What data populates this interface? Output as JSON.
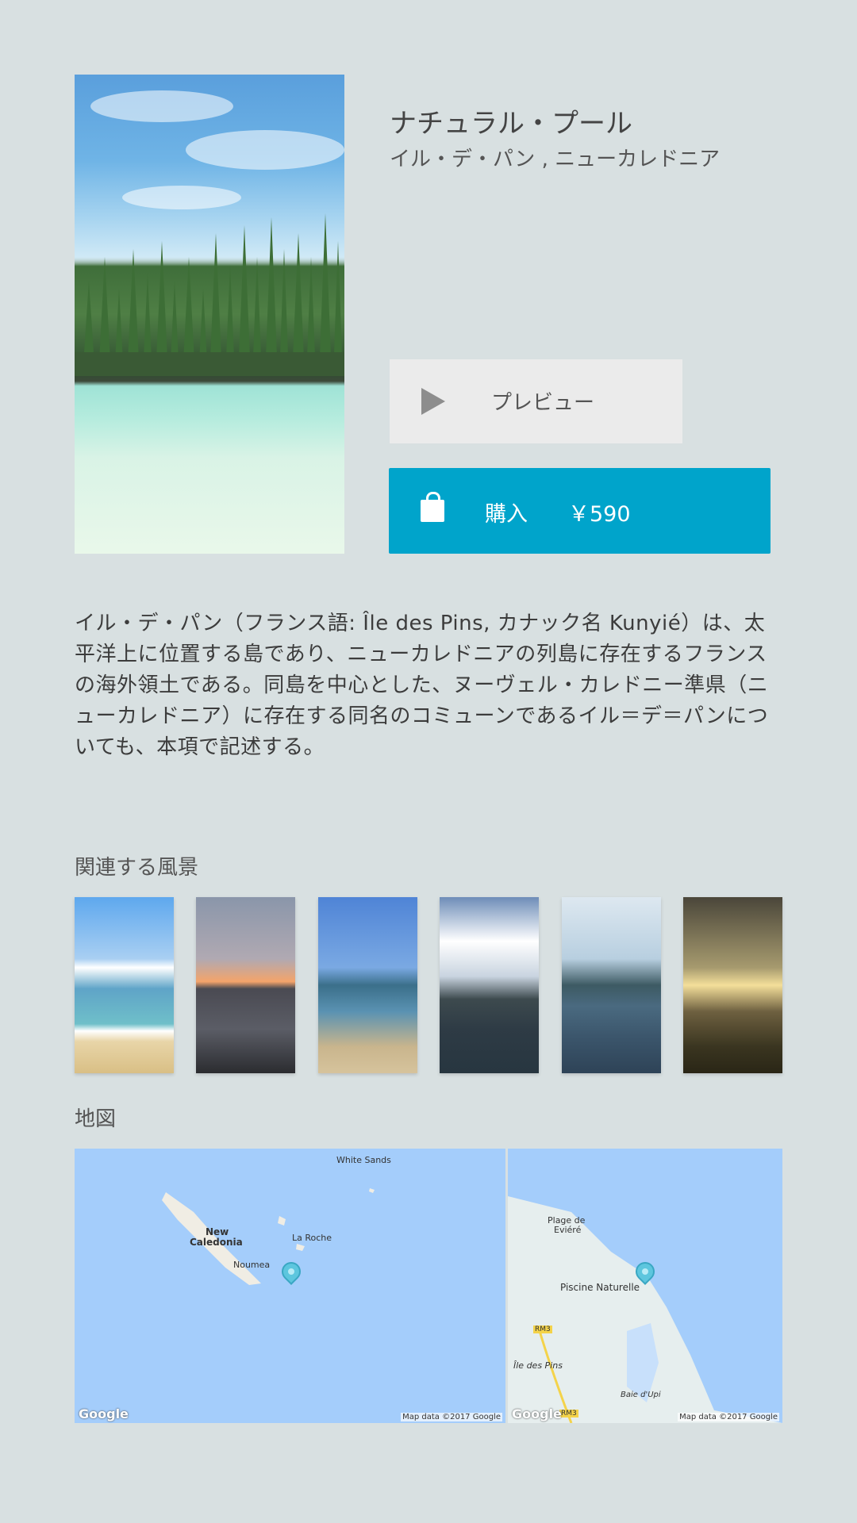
{
  "item": {
    "title": "ナチュラル・プール",
    "subtitle": "イル・デ・パン , ニューカレドニア"
  },
  "actions": {
    "preview_label": "プレビュー",
    "buy_label": "購入",
    "price": "￥590"
  },
  "description": "イル・デ・パン（フランス語: Île des Pins, カナック名 Kunyié）は、太平洋上に位置する島であり、ニューカレドニアの列島に存在するフランスの海外領土である。同島を中心とした、ヌーヴェル・カレドニー準県（ニューカレドニア）に存在する同名のコミューンであるイル＝デ＝パンについても、本項で記述する。",
  "related": {
    "label": "関連する風景",
    "count": 6
  },
  "map": {
    "label": "地図",
    "left": {
      "places": [
        "White Sands",
        "New",
        "Caledonia",
        "La Roche",
        "Noumea"
      ],
      "attribution": "Map data ©2017 Google",
      "logo": "Google"
    },
    "right": {
      "places": [
        "Plage de",
        "Eviéré",
        "Piscine Naturelle",
        "RM3",
        "Île des Pins",
        "Baie d'Upi",
        "RM3"
      ],
      "attribution": "Map data ©2017 Google",
      "logo": "Google"
    }
  },
  "icons": {
    "play": "play-icon",
    "bag": "shopping-bag-icon",
    "pin": "map-pin-icon"
  },
  "colors": {
    "background": "#d8e0e1",
    "accent": "#00a4cb",
    "preview_bg": "#ebebeb",
    "map_water": "#a4cdfb"
  }
}
